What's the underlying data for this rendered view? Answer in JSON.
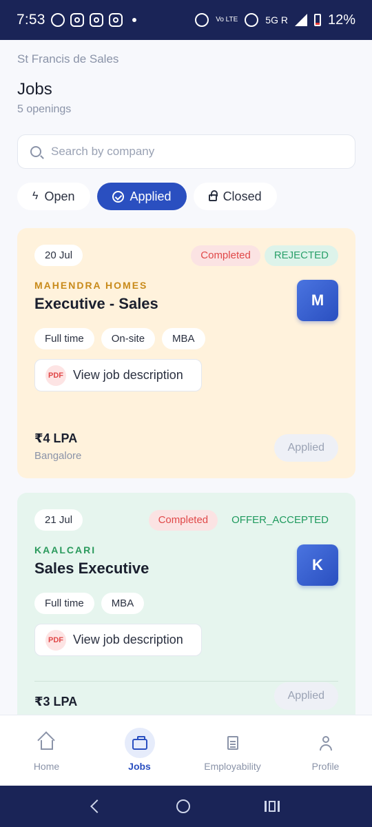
{
  "status_bar": {
    "time": "7:53",
    "network_small": "Vo LTE",
    "network": "5G R",
    "battery": "12%"
  },
  "header": {
    "school": "St Francis de Sales",
    "title": "Jobs",
    "openings": "5 openings"
  },
  "search": {
    "placeholder": "Search by company"
  },
  "tabs": [
    {
      "label": "Open",
      "icon": "bolt-icon",
      "active": false
    },
    {
      "label": "Applied",
      "icon": "check-circle-icon",
      "active": true
    },
    {
      "label": "Closed",
      "icon": "lock-icon",
      "active": false
    }
  ],
  "jobs": [
    {
      "date": "20 Jul",
      "status": "Completed",
      "result": "REJECTED",
      "company": "MAHENDRA HOMES",
      "title": "Executive - Sales",
      "logo_letter": "M",
      "tags": [
        "Full time",
        "On-site",
        "MBA"
      ],
      "pdf_label": "PDF",
      "description_label": "View job description",
      "salary": "₹4 LPA",
      "location": "Bangalore",
      "action": "Applied",
      "bg_color": "#fff2dc"
    },
    {
      "date": "21 Jul",
      "status": "Completed",
      "result": "OFFER_ACCEPTED",
      "company": "KAALCARI",
      "title": "Sales Executive",
      "logo_letter": "K",
      "tags": [
        "Full time",
        "MBA"
      ],
      "pdf_label": "PDF",
      "description_label": "View job description",
      "salary": "₹3 LPA",
      "action": "Applied",
      "bg_color": "#e6f5ee"
    }
  ],
  "bottom_nav": [
    {
      "label": "Home",
      "icon": "home-icon",
      "active": false
    },
    {
      "label": "Jobs",
      "icon": "briefcase-icon",
      "active": true
    },
    {
      "label": "Employability",
      "icon": "document-icon",
      "active": false
    },
    {
      "label": "Profile",
      "icon": "user-icon",
      "active": false
    }
  ],
  "colors": {
    "primary": "#2a4fc0",
    "status_bar": "#1a2457",
    "rejected": "#2aa06a",
    "completed": "#e04848"
  }
}
